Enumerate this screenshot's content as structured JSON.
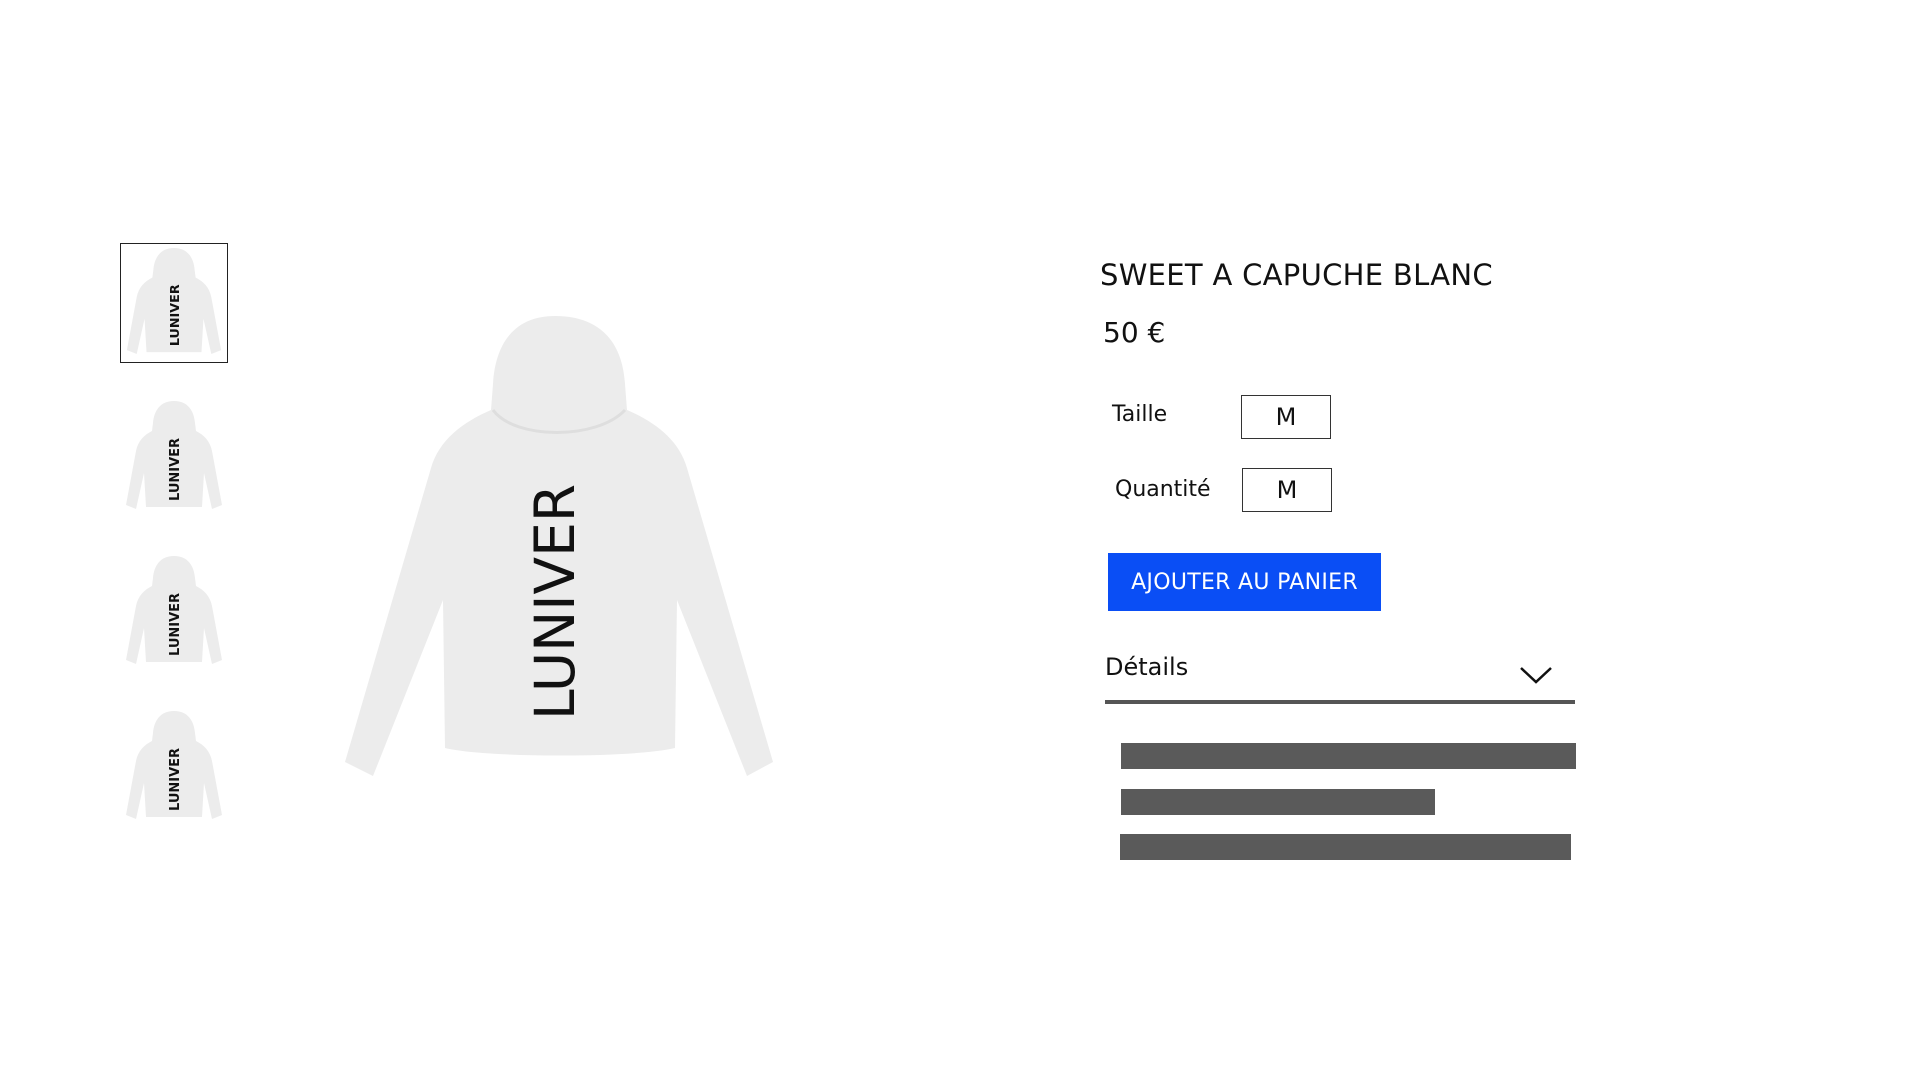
{
  "gallery": {
    "thumbnails": [
      {
        "label": "LUNIVER",
        "selected": true
      },
      {
        "label": "LUNIVER",
        "selected": false
      },
      {
        "label": "LUNIVER",
        "selected": false
      },
      {
        "label": "LUNIVER",
        "selected": false
      }
    ],
    "main_image_label": "LUNIVER",
    "garment_color": "#ececec",
    "print_color": "#111111"
  },
  "product": {
    "title": "SWEET A CAPUCHE BLANC",
    "price": "50 €",
    "size_label": "Taille",
    "size_value": "M",
    "quantity_label": "Quantité",
    "quantity_value": "M",
    "add_to_cart_label": "AJOUTER AU PANIER",
    "details_label": "Détails"
  },
  "colors": {
    "accent": "#0a4ef5",
    "placeholder": "#5a5a5a",
    "divider": "#555555"
  },
  "icons": {
    "details_toggle": "chevron-down-icon"
  }
}
